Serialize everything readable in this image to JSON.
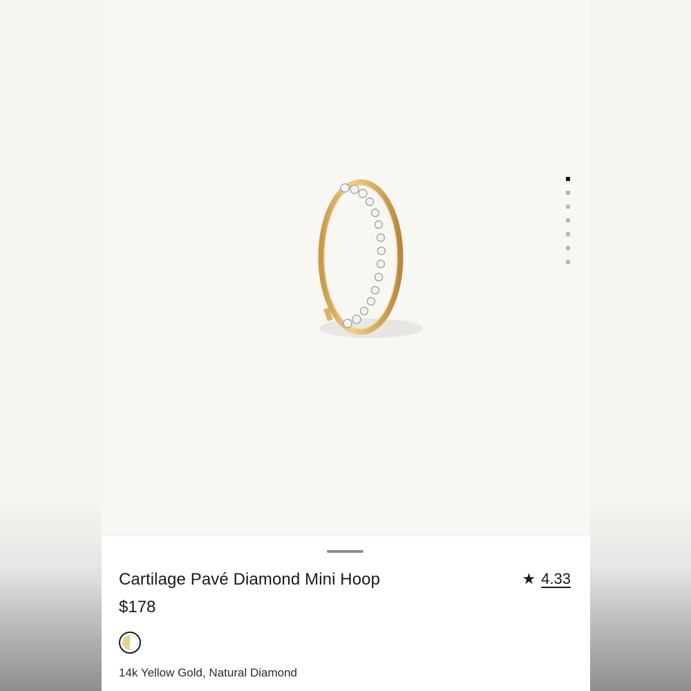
{
  "product": {
    "name": "Cartilage Pavé Diamond Mini Hoop",
    "price": "$178",
    "rating": "4.33",
    "material": "14k Yellow Gold, Natural Diamond"
  },
  "gallery": {
    "image_count": 7,
    "active_index": 0
  },
  "colors": {
    "gold": "#e7d28f",
    "background": "#f9f7f2"
  },
  "icons": {
    "rating": "star-icon"
  }
}
